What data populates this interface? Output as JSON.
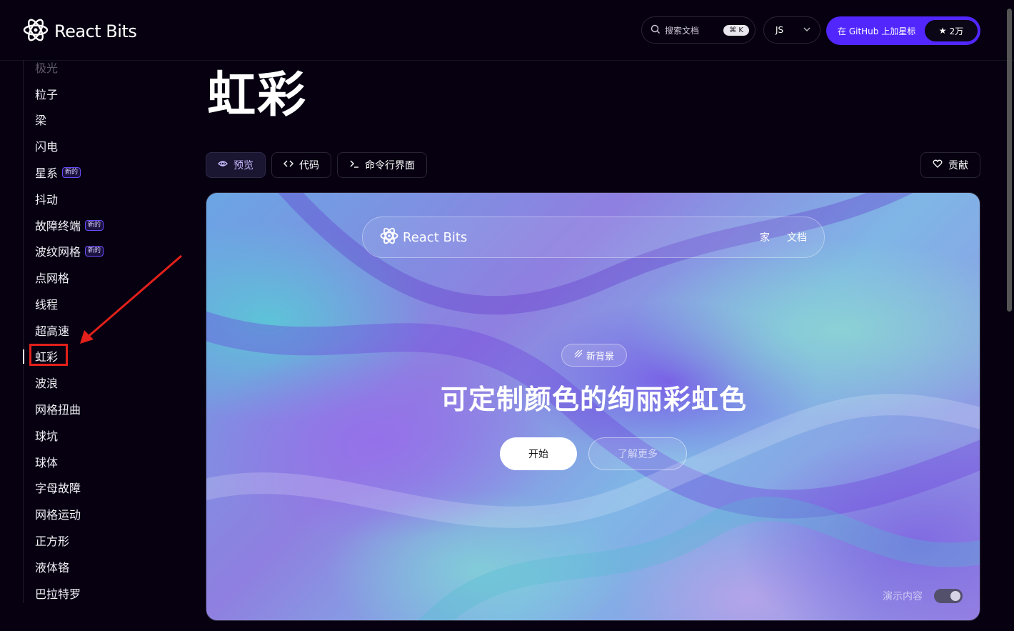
{
  "header": {
    "brand": "React Bits",
    "search_placeholder": "搜索文档",
    "search_shortcut": "⌘ K",
    "language": "JS",
    "github_label": "在 GitHub 上加星标",
    "github_stars": "2万"
  },
  "sidebar": {
    "items": [
      {
        "label": "极光",
        "badge": ""
      },
      {
        "label": "粒子",
        "badge": ""
      },
      {
        "label": "梁",
        "badge": ""
      },
      {
        "label": "闪电",
        "badge": ""
      },
      {
        "label": "星系",
        "badge": "新的"
      },
      {
        "label": "抖动",
        "badge": ""
      },
      {
        "label": "故障终端",
        "badge": "新的"
      },
      {
        "label": "波纹网格",
        "badge": "新的"
      },
      {
        "label": "点网格",
        "badge": ""
      },
      {
        "label": "线程",
        "badge": ""
      },
      {
        "label": "超高速",
        "badge": ""
      },
      {
        "label": "虹彩",
        "badge": ""
      },
      {
        "label": "波浪",
        "badge": ""
      },
      {
        "label": "网格扭曲",
        "badge": ""
      },
      {
        "label": "球坑",
        "badge": ""
      },
      {
        "label": "球体",
        "badge": ""
      },
      {
        "label": "字母故障",
        "badge": ""
      },
      {
        "label": "网格运动",
        "badge": ""
      },
      {
        "label": "正方形",
        "badge": ""
      },
      {
        "label": "液体铬",
        "badge": ""
      },
      {
        "label": "巴拉特罗",
        "badge": ""
      }
    ],
    "active": "虹彩"
  },
  "main": {
    "title": "虹彩",
    "tabs": {
      "preview": "预览",
      "code": "代码",
      "cli": "命令行界面"
    },
    "contribute": "贡献"
  },
  "preview": {
    "nav_brand": "React Bits",
    "nav_links": {
      "home": "家",
      "docs": "文档"
    },
    "badge": "新背景",
    "headline": "可定制颜色的绚丽彩虹色",
    "primary_cta": "开始",
    "secondary_cta": "了解更多",
    "demo_toggle_label": "演示内容",
    "demo_toggle_on": true
  },
  "colors": {
    "background": "#060010",
    "accent": "#5227ff",
    "annotation": "#e3201b"
  }
}
